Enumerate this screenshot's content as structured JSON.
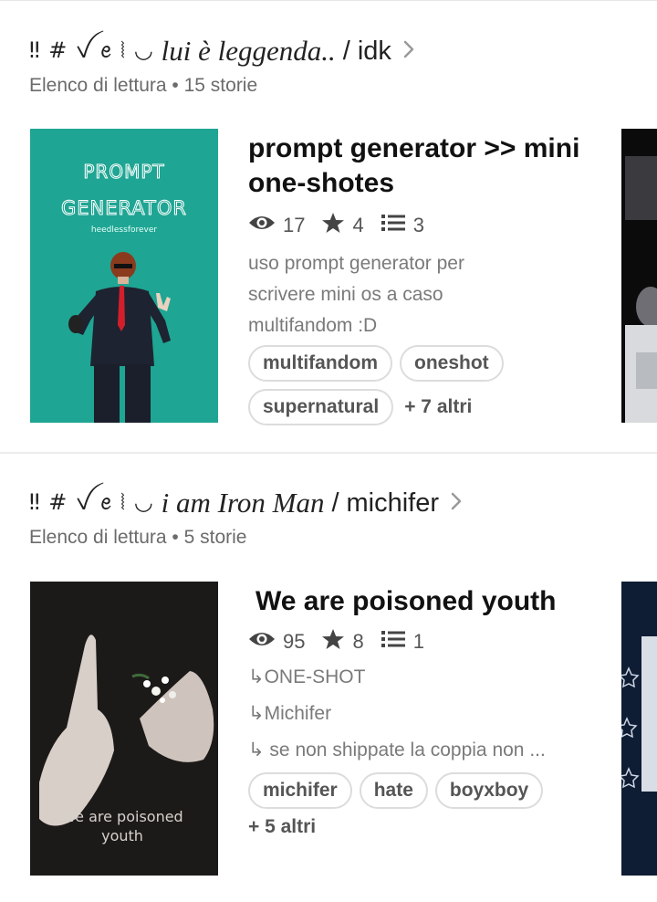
{
  "lists": [
    {
      "decor": "‼ # ꪜ ꫀ ⦚ ◡",
      "title": "lui è leggenda..",
      "separator": "/",
      "author": "idk",
      "subtitle": "Elenco di lettura • 15 storie",
      "story": {
        "title": "prompt generator >> mini one-shotes",
        "reads": "17",
        "votes": "4",
        "parts": "3",
        "description": [
          "uso prompt generator per",
          "scrivere mini os a caso",
          "multifandom :D"
        ],
        "tags": [
          "multifandom",
          "oneshot",
          "supernatural"
        ],
        "more_tags": "+ 7 altri",
        "cover": {
          "line1": "PROMPT",
          "line2": "GENERATOR",
          "credit": "heedlessforever",
          "bg": "#1fa593"
        }
      }
    },
    {
      "decor": "‼ # ꪜ ꫀ ⦚ ◡",
      "title": "i am Iron Man",
      "separator": "/",
      "author": "michifer",
      "subtitle": "Elenco di lettura • 5 storie",
      "story": {
        "title": "We are poisoned youth",
        "reads": "95",
        "votes": "8",
        "parts": "1",
        "description": [
          "↳ONE-SHOT",
          "↳Michifer",
          "↳ se non shippate la coppia non ..."
        ],
        "tags": [
          "michifer",
          "hate",
          "boyxboy"
        ],
        "more_tags": "+ 5 altri",
        "cover": {
          "line1": "We are poisoned",
          "line2": "youth",
          "bg": "#1c1a19"
        }
      }
    }
  ],
  "colors": {
    "text": "#222222",
    "muted": "#6b6b6b",
    "tag_border": "#dcdcdc",
    "icon": "#444444"
  }
}
